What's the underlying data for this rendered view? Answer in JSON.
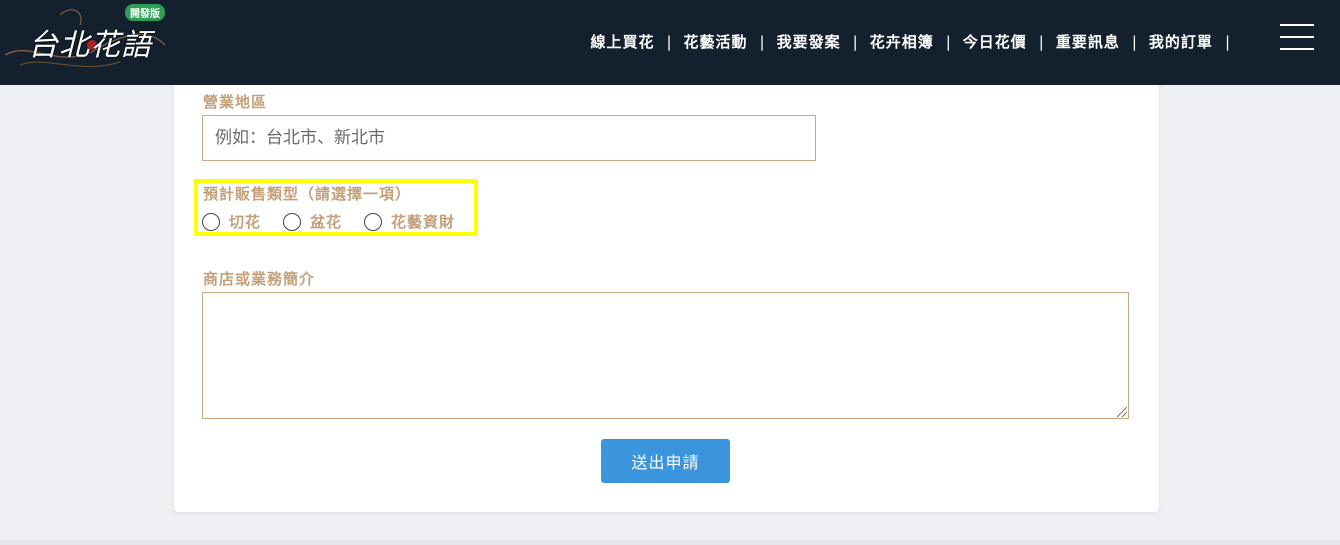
{
  "header": {
    "logo_text": "台北花語",
    "badge": "開發版",
    "nav": [
      "線上買花",
      "花藝活動",
      "我要發案",
      "花卉相簿",
      "今日花價",
      "重要訊息",
      "我的訂單"
    ],
    "separator": "|",
    "menu_icon": "hamburger-icon"
  },
  "form": {
    "area_label": "營業地區",
    "area_placeholder": "例如：台北市、新北市",
    "type_label": "預計販售類型（請選擇一項）",
    "type_options": [
      "切花",
      "盆花",
      "花藝資財"
    ],
    "intro_label": "商店或業務簡介",
    "submit_label": "送出申請"
  },
  "colors": {
    "header_bg": "#14202e",
    "label": "#c4a07a",
    "button": "#3b95dd",
    "highlight": "#ffff00"
  }
}
